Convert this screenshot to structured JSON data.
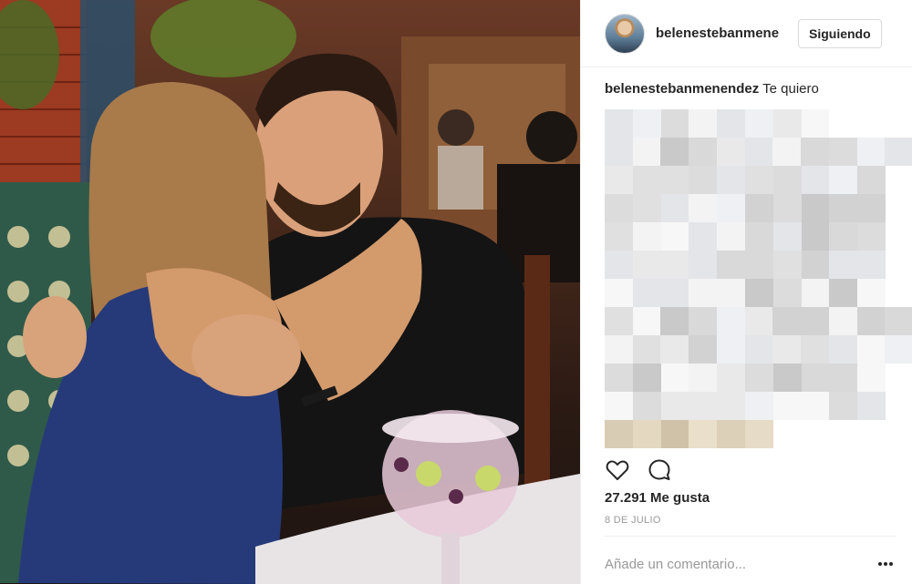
{
  "header": {
    "username": "belenestebanmenendez",
    "follow_label": "Siguiendo"
  },
  "caption": {
    "username": "belenestebanmenendez",
    "text": "Te quiero"
  },
  "post": {
    "likes": "27.291 Me gusta",
    "date": "8 DE JULIO"
  },
  "comment": {
    "placeholder": "Añade un comentario..."
  },
  "icons": {
    "like": "heart-icon",
    "comment": "comment-bubble-icon",
    "more": "more-dots-icon"
  },
  "colors": {
    "text": "#262626",
    "muted": "#999999",
    "border": "#dbdbdb"
  }
}
